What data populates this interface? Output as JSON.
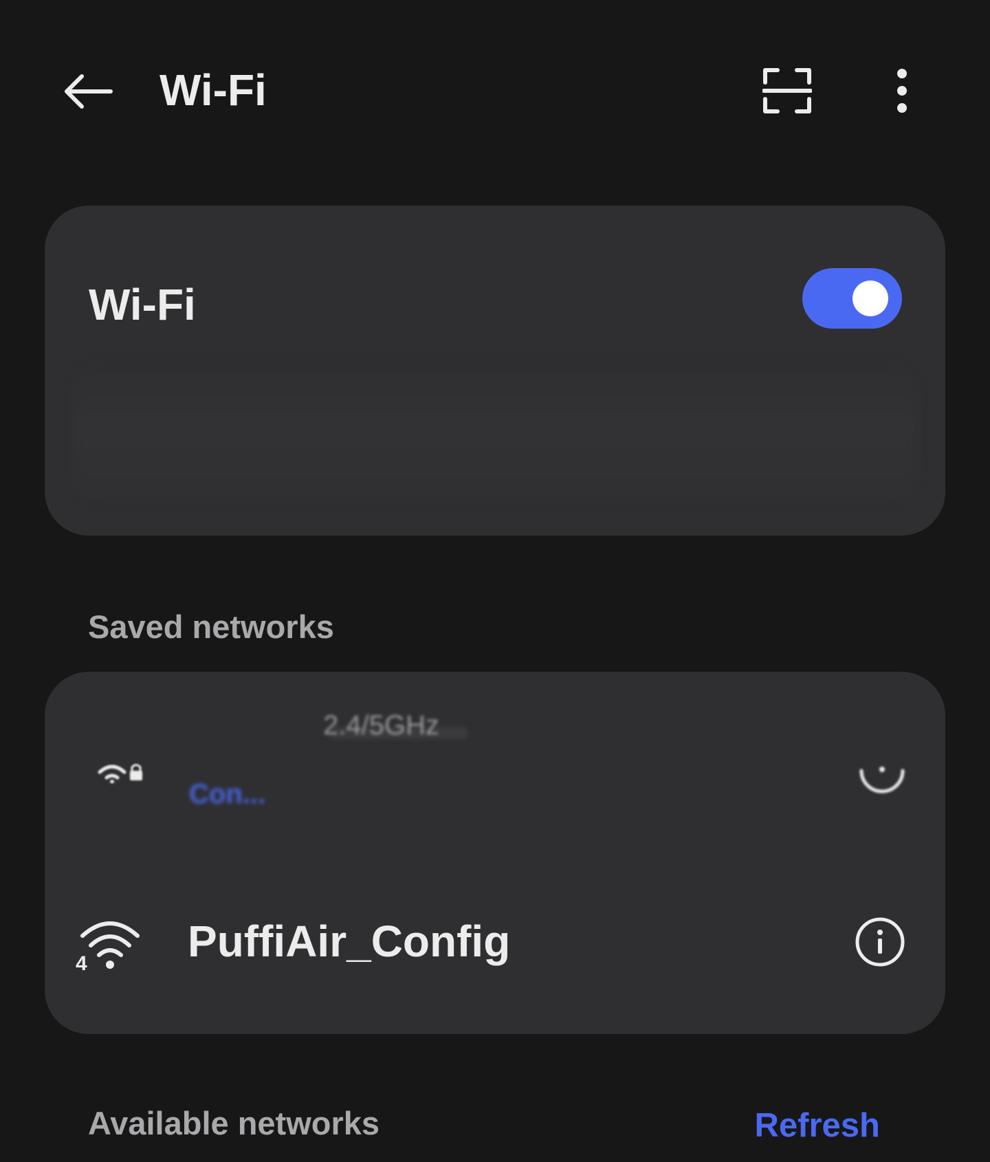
{
  "appbar": {
    "title": "Wi-Fi",
    "back_icon": "arrow-left-icon",
    "scan_icon": "qr-scan-icon",
    "more_icon": "more-vertical-icon"
  },
  "wifi_toggle": {
    "label": "Wi-Fi",
    "enabled": true,
    "accent_color": "#4a69f2"
  },
  "saved_networks": {
    "header": "Saved networks",
    "items": [
      {
        "name": "",
        "band": "2.4/5GHz",
        "status": "Con...",
        "secured": true,
        "icon": "wifi-lock-icon",
        "action_icon": "info-icon",
        "redacted": true
      },
      {
        "name": "PuffiAir_Config",
        "signal_label": "4",
        "icon": "wifi-4-icon",
        "action_icon": "info-icon"
      }
    ]
  },
  "available_networks": {
    "header": "Available networks",
    "refresh_label": "Refresh"
  },
  "colors": {
    "background": "#171718",
    "card": "#2f2f31",
    "accent": "#4a69f2",
    "text_primary": "#ececec",
    "text_secondary": "#a9a9ab"
  }
}
